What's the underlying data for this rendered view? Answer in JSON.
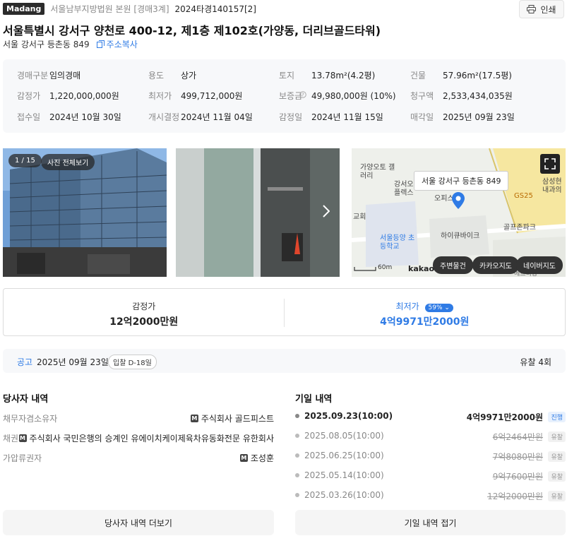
{
  "header": {
    "logo": "Madang",
    "court": "서울남부지방법원 본원 [경매3계]",
    "case_number": "2024타경140157[2]",
    "print_label": "인쇄"
  },
  "property": {
    "title": "서울특별시 강서구 양천로 400-12, 제1층 제102호(가양동, 더리브골드타워)",
    "sub_address": "서울 강서구 등촌동 849",
    "copy_label": "주소복사"
  },
  "info": {
    "row1": [
      {
        "label": "경매구분",
        "value": "임의경매"
      },
      {
        "label": "용도",
        "value": "상가"
      },
      {
        "label": "토지",
        "value": "13.78m²(4.2평)"
      },
      {
        "label": "건물",
        "value": "57.96m²(17.5평)"
      }
    ],
    "row2": [
      {
        "label": "감정가",
        "value": "1,220,000,000원"
      },
      {
        "label": "최저가",
        "value": "499,712,000원"
      },
      {
        "label": "보증금",
        "value": "49,980,000원 (10%)"
      },
      {
        "label": "청구액",
        "value": "2,533,434,035원"
      }
    ],
    "row3": [
      {
        "label": "접수일",
        "value": "2024년 10월 30일"
      },
      {
        "label": "개시결정",
        "value": "2024년 11월 04일"
      },
      {
        "label": "감정일",
        "value": "2024년 11월 15일"
      },
      {
        "label": "매각일",
        "value": "2025년 09월 23일"
      }
    ]
  },
  "gallery": {
    "counter": "1 / 15",
    "all_photos": "사진 전체보기"
  },
  "map": {
    "marker_label": "서울 강서구 등촌동 849",
    "places": [
      "가양오토 갤러리",
      "강서오 플렉스",
      "오피스",
      "GS25",
      "삼성현 내과의",
      "교회",
      "서울등양 초등학교",
      "하이큐바이크",
      "골프존파크",
      "메르디앙"
    ],
    "scale": "60m",
    "brand": "kakao",
    "buttons": [
      "주변물건",
      "카카오지도",
      "네이버지도"
    ]
  },
  "prices": {
    "appraisal_label": "감정가",
    "appraisal_value": "12억2000만원",
    "minimum_label": "최저가",
    "minimum_pct": "59%",
    "minimum_value": "4억9971만2000원"
  },
  "notice": {
    "label": "공고",
    "date": "2025년 09월 23일",
    "dday": "입찰 D-18일",
    "failed": "유찰 4회"
  },
  "parties": {
    "title": "당사자 내역",
    "items": [
      {
        "label": "채무자겸소유자",
        "value": "주식회사 골드피스트"
      },
      {
        "label": "채권자",
        "value": "주식회사 국민은행의 승계인 유에이치케이제육차유동화전문 유한회사"
      },
      {
        "label": "가압류권자",
        "value": "조성훈"
      }
    ],
    "more_button": "당사자 내역 더보기"
  },
  "schedule": {
    "title": "기일 내역",
    "items": [
      {
        "date": "2025.09.23(10:00)",
        "amount": "4억9971만2000원",
        "status": "진행"
      },
      {
        "date": "2025.08.05(10:00)",
        "amount": "6억2464만원",
        "status": "유찰"
      },
      {
        "date": "2025.06.25(10:00)",
        "amount": "7억8080만원",
        "status": "유찰"
      },
      {
        "date": "2025.05.14(10:00)",
        "amount": "9억7600만원",
        "status": "유찰"
      },
      {
        "date": "2025.03.26(10:00)",
        "amount": "12억2000만원",
        "status": "유찰"
      }
    ],
    "collapse_button": "기일 내역 접기"
  },
  "colors": {
    "accent": "#2f7be5",
    "text": "#222222",
    "muted": "#888888"
  }
}
